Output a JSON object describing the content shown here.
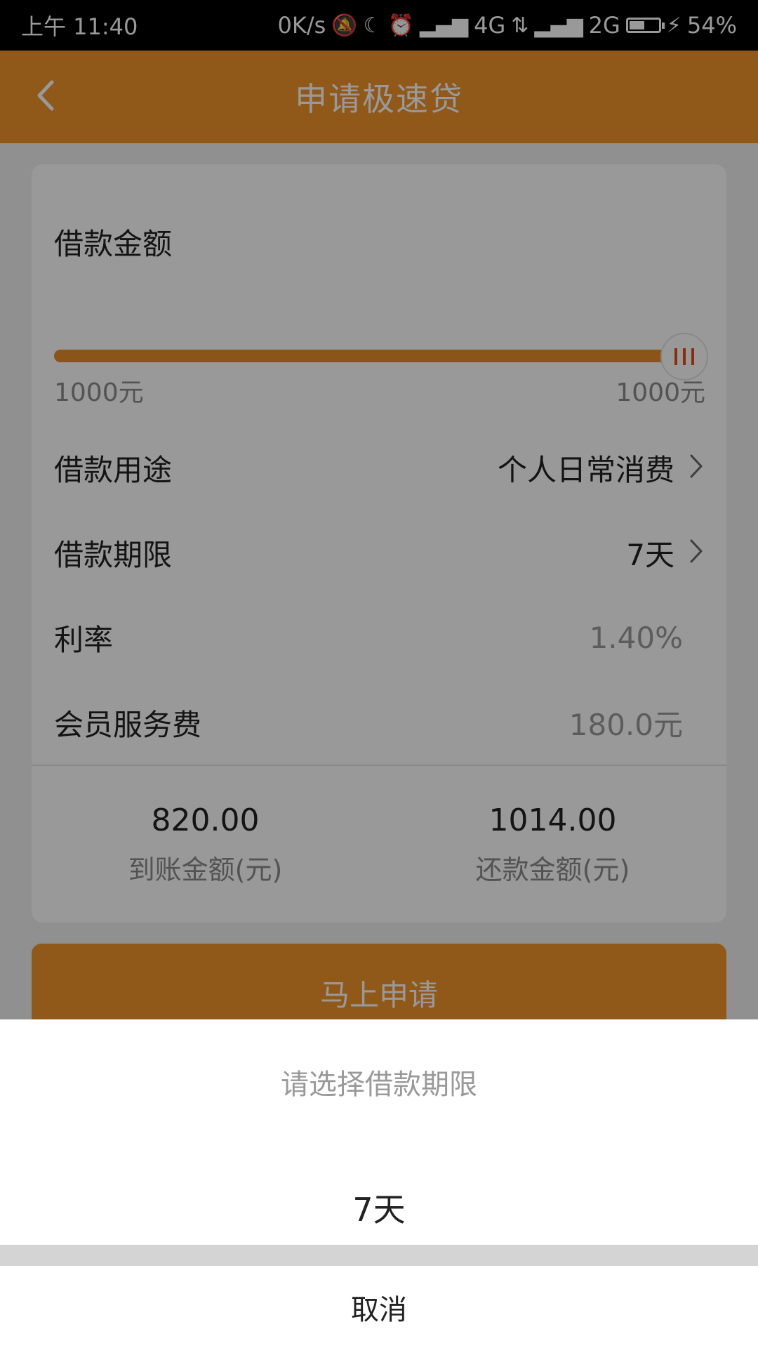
{
  "status_bar": {
    "time": "上午 11:40",
    "network_speed": "0K/s",
    "net_4g": "4G",
    "net_2g": "2G",
    "battery_percent": "54%",
    "battery_level": 0.54,
    "icons": [
      "mute-icon",
      "moon-icon",
      "alarm-icon",
      "signal-icon",
      "data-arrows-icon",
      "battery-icon",
      "charging-icon"
    ]
  },
  "header": {
    "title": "申请极速贷",
    "back_icon": "chevron-left-icon",
    "background": "#f0932b"
  },
  "loan": {
    "amount_label": "借款金额",
    "slider_min": "1000元",
    "slider_max": "1000元",
    "slider_fraction": 1.0,
    "purpose_label": "借款用途",
    "purpose_value": "个人日常消费",
    "term_label": "借款期限",
    "term_value": "7天",
    "rate_label": "利率",
    "rate_value": "1.40%",
    "fee_label": "会员服务费",
    "fee_value": "180.0元",
    "received_amount": "820.00",
    "received_caption": "到账金额(元)",
    "repay_amount": "1014.00",
    "repay_caption": "还款金额(元)"
  },
  "apply_button": "马上申请",
  "sheet": {
    "title": "请选择借款期限",
    "option": "7天",
    "cancel": "取消"
  }
}
